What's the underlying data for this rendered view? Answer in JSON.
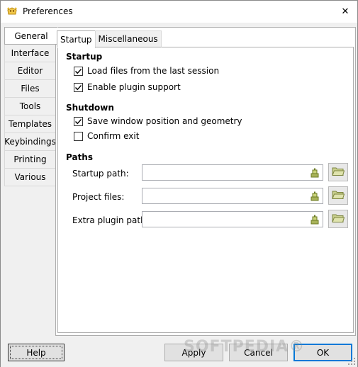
{
  "window": {
    "title": "Preferences",
    "close_glyph": "✕"
  },
  "side_tabs": [
    {
      "label": "General",
      "active": true
    },
    {
      "label": "Interface"
    },
    {
      "label": "Editor"
    },
    {
      "label": "Files"
    },
    {
      "label": "Tools"
    },
    {
      "label": "Templates"
    },
    {
      "label": "Keybindings"
    },
    {
      "label": "Printing"
    },
    {
      "label": "Various"
    }
  ],
  "top_tabs": [
    {
      "label": "Startup",
      "active": true
    },
    {
      "label": "Miscellaneous"
    }
  ],
  "startup": {
    "title": "Startup",
    "load_files": {
      "label": "Load files from the last session",
      "checked": true
    },
    "plugin_support": {
      "label": "Enable plugin support",
      "checked": true
    }
  },
  "shutdown": {
    "title": "Shutdown",
    "save_geometry": {
      "label": "Save window position and geometry",
      "checked": true
    },
    "confirm_exit": {
      "label": "Confirm exit",
      "checked": false
    }
  },
  "paths": {
    "title": "Paths",
    "startup_path": {
      "label": "Startup path:",
      "value": ""
    },
    "project_files": {
      "label": "Project files:",
      "value": ""
    },
    "extra_plugin_path": {
      "label": "Extra plugin path:",
      "value": ""
    }
  },
  "buttons": {
    "help": "Help",
    "apply": "Apply",
    "cancel": "Cancel",
    "ok": "OK"
  },
  "watermark": "SOFTPEDIA®",
  "icons": {
    "app": "geany-icon",
    "field": "clear-field-icon",
    "folder": "open-folder-icon"
  },
  "colors": {
    "accent": "#0078d7",
    "check": "#000000",
    "folder": "#a8b35a"
  }
}
